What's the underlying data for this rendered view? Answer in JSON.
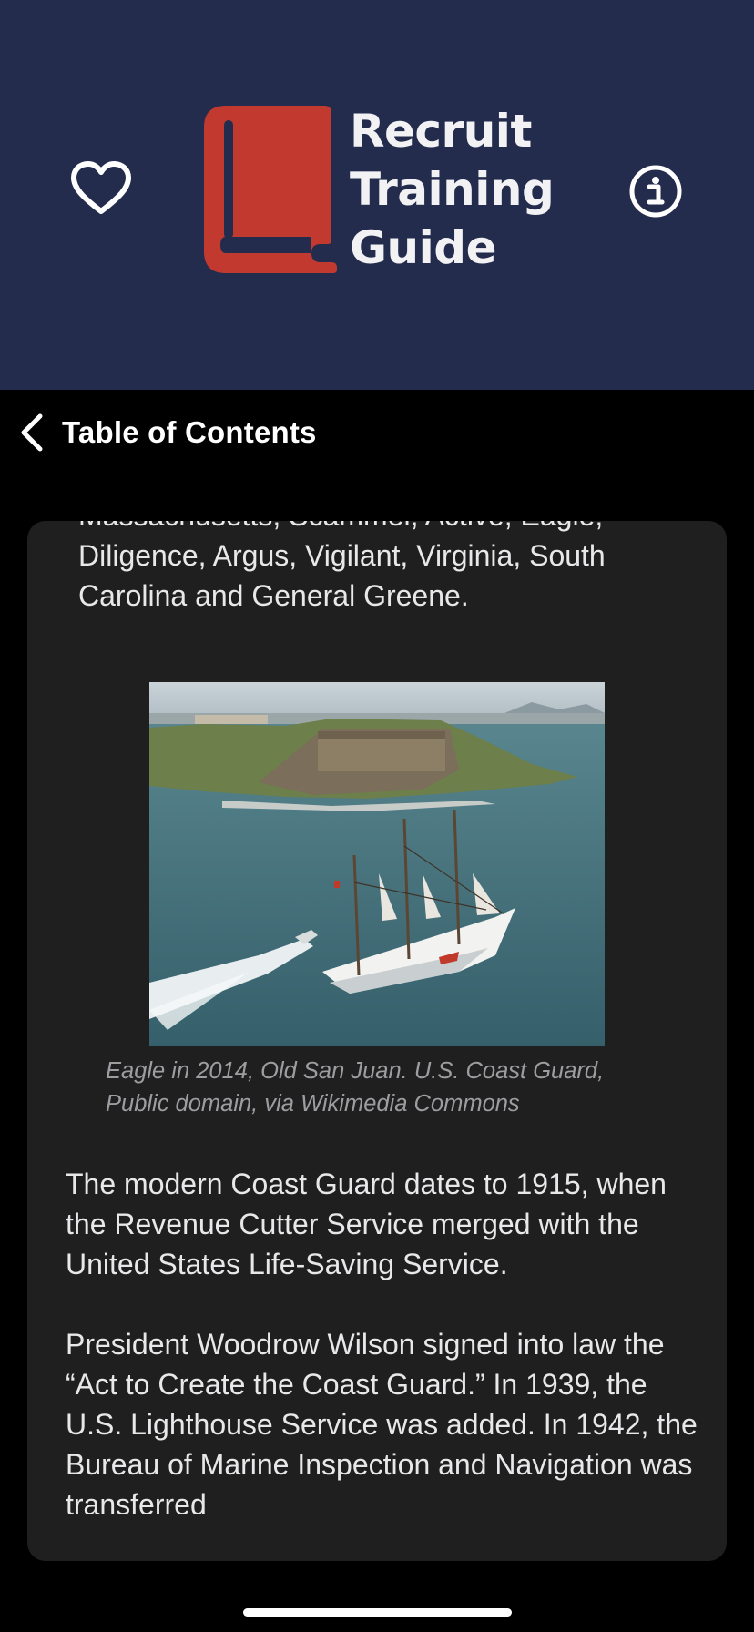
{
  "header": {
    "app_title_lines": [
      "Recruit",
      "Training",
      "Guide"
    ],
    "favorite_icon": "heart-outline-icon",
    "info_icon": "info-circle-icon",
    "logo_icon": "book-icon",
    "colors": {
      "background": "#232c4d",
      "logo_red": "#c23a2f",
      "title_text": "#f2f2f4"
    }
  },
  "nav": {
    "back_icon": "chevron-left-icon",
    "back_label": "Table of Contents"
  },
  "article": {
    "top_paragraph": "Massachusetts, Scammel, Active, Eagle, Diligence, Argus, Vigilant, Virginia, South Carolina and General Greene.",
    "image_caption": "Eagle in 2014, Old San Juan. U.S. Coast Guard, Public domain, via Wikimedia Commons",
    "paragraphs": [
      "The modern Coast Guard dates to 1915, when the Revenue Cutter Service merged with the United States Life-Saving Service.",
      "President Woodrow Wilson signed into law the “Act to Create the Coast Guard.” In 1939, the U.S. Lighthouse Service was added. In 1942, the Bureau of Marine Inspection and Navigation was transferred"
    ]
  }
}
